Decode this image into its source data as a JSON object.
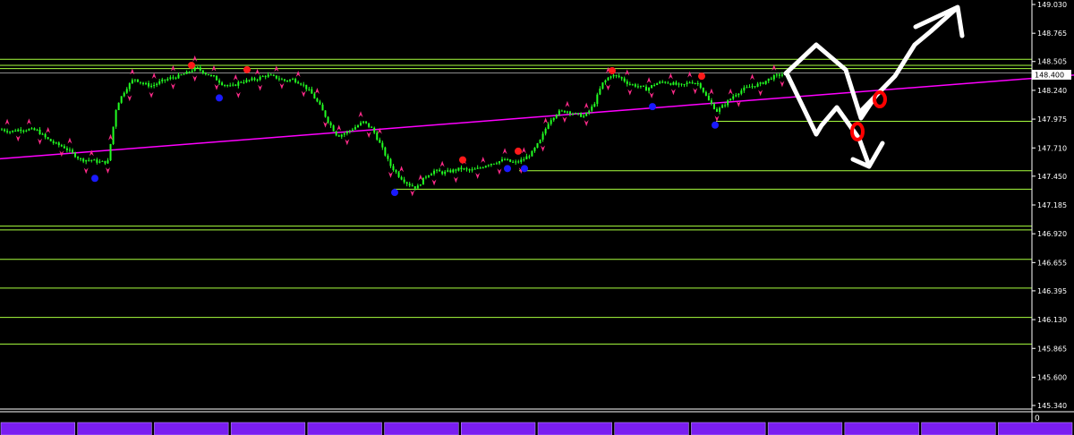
{
  "colors": {
    "background": "#000000",
    "candle": "#22ff22",
    "level_line": "#a8ff3e",
    "trend_line": "#ff00ff",
    "current_price_line": "#8c8c8c",
    "fractal_arrow": "#ff2b8a",
    "marker_high": "#ff1a1a",
    "marker_low": "#1a1aff",
    "annotation_white": "#ffffff",
    "annotation_red": "#ff0000",
    "axis_text": "#ffffff",
    "tab_fill": "#7a1ef0"
  },
  "chart_data": {
    "type": "candlestick",
    "title": "",
    "xlabel": "",
    "ylabel": "",
    "grid": false,
    "ylim": [
      145.14,
      149.11
    ],
    "y_ticks": [
      "149.030",
      "148.765",
      "148.505",
      "148.240",
      "147.975",
      "147.710",
      "147.450",
      "147.185",
      "146.920",
      "146.655",
      "146.395",
      "146.130",
      "145.865",
      "145.600",
      "145.340"
    ],
    "current_price": "148.400",
    "series": [
      {
        "values": [
          147.88,
          147.86,
          147.88,
          147.88,
          147.87,
          147.8,
          147.75,
          147.72,
          147.66,
          147.6,
          147.6,
          147.58,
          147.58,
          148.1,
          148.25,
          148.35,
          148.3,
          148.28,
          148.32,
          148.35,
          148.37,
          148.4,
          148.45,
          148.4,
          148.36,
          148.3,
          148.27,
          148.32,
          148.33,
          148.35,
          148.38,
          148.36,
          148.33,
          148.34,
          148.3,
          148.22,
          148.1,
          147.95,
          147.82,
          147.85,
          147.9,
          147.95,
          147.88,
          147.72,
          147.55,
          147.45,
          147.38,
          147.34,
          147.45,
          147.5,
          147.48,
          147.5,
          147.52,
          147.5,
          147.52,
          147.56,
          147.58,
          147.6,
          147.57,
          147.6,
          147.66,
          147.78,
          147.96,
          148.04,
          148.05,
          148.02,
          148.0,
          148.1,
          148.3,
          148.38,
          148.36,
          148.3,
          148.28,
          148.25,
          148.3,
          148.32,
          148.3,
          148.28,
          148.32,
          148.3,
          148.15,
          148.05,
          148.12,
          148.2,
          148.25,
          148.28,
          148.3,
          148.35,
          148.38,
          148.4
        ]
      }
    ],
    "levels": [
      148.525,
      148.47,
      148.44,
      147.955,
      147.5,
      147.33,
      146.99,
      146.955,
      146.685,
      146.42,
      146.15,
      145.905
    ],
    "trendline": {
      "start": 147.61,
      "end": 148.38
    },
    "swing_high_markers": [
      148.47,
      148.43,
      148.43,
      147.6,
      147.68,
      148.42,
      148.37
    ],
    "swing_low_markers": [
      147.43,
      148.17,
      147.3,
      147.52,
      147.52,
      148.09,
      147.92
    ],
    "fractal_up_count": 38,
    "fractal_down_count": 36
  },
  "x_axis": {
    "scale_label": "0",
    "tab_labels": [
      "",
      "",
      "",
      "",
      "",
      "",
      "",
      "",
      "",
      "",
      "",
      "",
      "",
      ""
    ]
  },
  "annotations": {
    "arrows": [
      "up-arrow",
      "down-arrow"
    ],
    "circles": [
      "red-circle",
      "red-circle"
    ]
  }
}
